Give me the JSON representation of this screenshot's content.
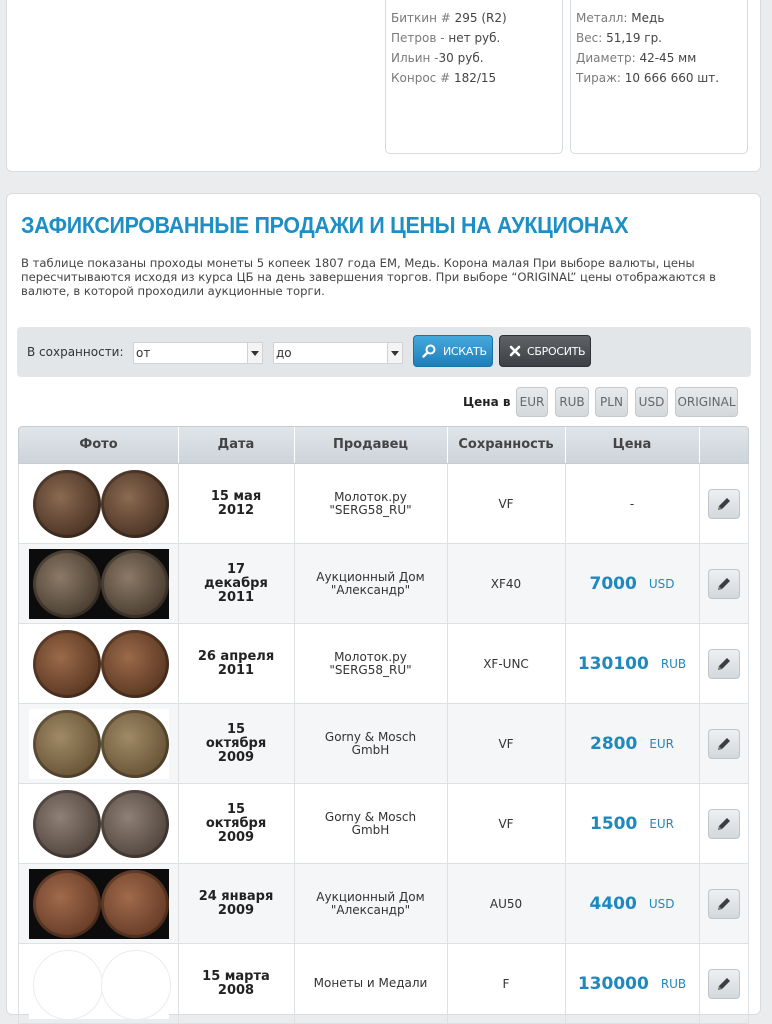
{
  "top_info": {
    "left_box": [
      {
        "key": "Биткин #",
        "value": "295 (R2)"
      },
      {
        "key": "Петров -",
        "value": "нет руб."
      },
      {
        "key": "Ильин -",
        "value": "30 руб."
      },
      {
        "key": "Конрос #",
        "value": "182/15"
      }
    ],
    "right_box": [
      {
        "key": "Металл:",
        "value": "Медь"
      },
      {
        "key": "Вес:",
        "value": "51,19 гр."
      },
      {
        "key": "Диаметр:",
        "value": "42-45 мм"
      },
      {
        "key": "Тираж:",
        "value": "10 666 660 шт."
      }
    ]
  },
  "section": {
    "title": "ЗАФИКСИРОВАННЫЕ ПРОДАЖИ И ЦЕНЫ НА АУКЦИОНАХ",
    "description": "В таблице показаны проходы монеты 5 копеек 1807 года ЕМ, Медь. Корона малая При выборе валюты, цены пересчитываются исходя из курса ЦБ на день завершения торгов. При выборе “ORIGINAL” цены отображаются в валюте, в которой проходили аукционные торги."
  },
  "filter": {
    "label": "В сохранности:",
    "from_value": "от",
    "to_value": "до",
    "search_label": "ИСКАТЬ",
    "reset_label": "СБРОСИТЬ"
  },
  "currency": {
    "label": "Цена в",
    "options": [
      "EUR",
      "RUB",
      "PLN",
      "USD",
      "ORIGINAL"
    ]
  },
  "table": {
    "headers": [
      "Фото",
      "Дата",
      "Продавец",
      "Сохранность",
      "Цена",
      ""
    ],
    "rows": [
      {
        "date": "15 мая 2012",
        "seller": "Молоток.ру \"SERG58_RU\"",
        "condition": "VF",
        "price": "-",
        "currency": "",
        "photo": "dark-bronze"
      },
      {
        "date": "17 декабря 2011",
        "seller": "Аукционный Дом \"Александр\"",
        "condition": "XF40",
        "price": "7000",
        "currency": "USD",
        "photo": "black-bg"
      },
      {
        "date": "26 апреля 2011",
        "seller": "Молоток.ру \"SERG58_RU\"",
        "condition": "XF-UNC",
        "price": "130100",
        "currency": "RUB",
        "photo": "brown"
      },
      {
        "date": "15 октября 2009",
        "seller": "Gorny & Mosch GmbH",
        "condition": "VF",
        "price": "2800",
        "currency": "EUR",
        "photo": "olive"
      },
      {
        "date": "15 октября 2009",
        "seller": "Gorny & Mosch GmbH",
        "condition": "VF",
        "price": "1500",
        "currency": "EUR",
        "photo": "grey-brown"
      },
      {
        "date": "24 января 2009",
        "seller": "Аукционный Дом \"Александр\"",
        "condition": "AU50",
        "price": "4400",
        "currency": "USD",
        "photo": "black-bg-copper"
      },
      {
        "date": "15 марта 2008",
        "seller": "Монеты и Медали",
        "condition": "F",
        "price": "130000",
        "currency": "RUB",
        "photo": "no-image"
      }
    ]
  }
}
